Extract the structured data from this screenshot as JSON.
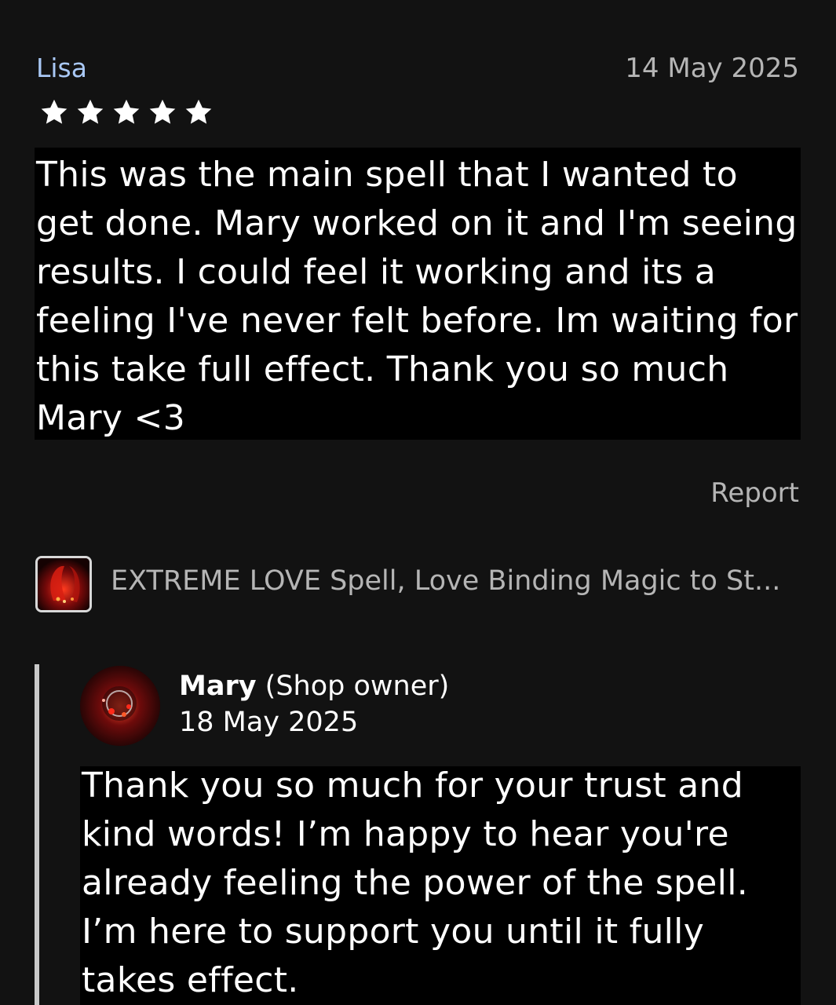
{
  "review": {
    "reviewer_name": "Lisa",
    "date": "14 May 2025",
    "rating": 5,
    "text": "This was the main spell that I wanted to get done. Mary worked on it and I'm seeing results. I could feel it working and its a feeling I've never felt before. Im waiting for this take full effect. Thank you so much Mary <3",
    "report_label": "Report"
  },
  "listing": {
    "title": "EXTREME LOVE Spell, Love Binding Magic to St..."
  },
  "reply": {
    "owner_name": "Mary",
    "owner_role": "(Shop owner)",
    "date": "18 May 2025",
    "text": "Thank you so much for your trust and kind words! I’m happy to hear you're already feeling the power of the spell. I’m here to support you until it fully takes effect."
  },
  "icons": {
    "star": "star-icon",
    "listing_thumbnail": "listing-thumbnail",
    "avatar": "owner-avatar"
  },
  "colors": {
    "background": "#121212",
    "reviewer_name": "#a9c8f5",
    "muted_text": "#b5b5b5",
    "text_highlight_bg": "#000000"
  }
}
